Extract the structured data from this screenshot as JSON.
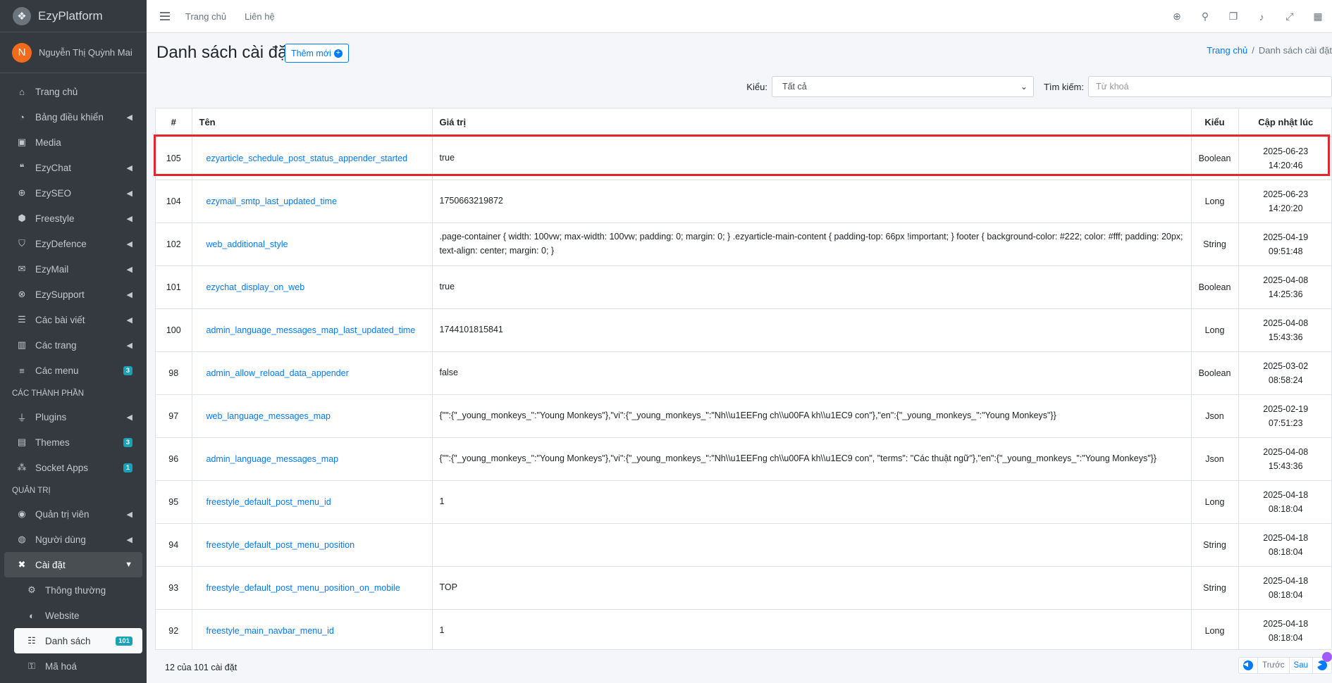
{
  "brand": {
    "name": "EzyPlatform",
    "logo_icon": "logo-icon"
  },
  "user": {
    "initial": "N",
    "name": "Nguyễn Thị Quỳnh Mai"
  },
  "sidebar": {
    "items": [
      {
        "label": "Trang chủ",
        "icon": "home-icon"
      },
      {
        "label": "Bảng điều khiển",
        "icon": "dashboard-icon"
      },
      {
        "label": "Media",
        "icon": "image-icon"
      },
      {
        "label": "EzyChat",
        "icon": "chat-icon"
      },
      {
        "label": "EzySEO",
        "icon": "search-plus-icon"
      },
      {
        "label": "Freestyle",
        "icon": "cube-icon"
      },
      {
        "label": "EzyDefence",
        "icon": "shield-icon"
      },
      {
        "label": "EzyMail",
        "icon": "mail-icon"
      },
      {
        "label": "EzySupport",
        "icon": "support-icon"
      },
      {
        "label": "Các bài viết",
        "icon": "list-icon"
      },
      {
        "label": "Các trang",
        "icon": "book-icon"
      },
      {
        "label": "Các menu",
        "icon": "menu-icon",
        "badge": "3"
      }
    ],
    "section_components": "CÁC THÀNH PHẦN",
    "components": [
      {
        "label": "Plugins",
        "icon": "plug-icon"
      },
      {
        "label": "Themes",
        "icon": "theme-icon",
        "badge": "3"
      },
      {
        "label": "Socket Apps",
        "icon": "apps-icon",
        "badge": "1"
      }
    ],
    "section_admin": "QUẢN TRỊ",
    "admin": [
      {
        "label": "Quản trị viên",
        "icon": "user-icon"
      },
      {
        "label": "Người dùng",
        "icon": "users-icon"
      },
      {
        "label": "Cài đặt",
        "icon": "tools-icon"
      }
    ],
    "settings_sub": [
      {
        "label": "Thông thường",
        "icon": "gears-icon"
      },
      {
        "label": "Website",
        "icon": "globe-icon"
      },
      {
        "label": "Danh sách",
        "icon": "list-ul-icon",
        "badge": "101"
      },
      {
        "label": "Mã hoá",
        "icon": "key-icon"
      }
    ]
  },
  "topbar": {
    "home": "Trang chủ",
    "contact": "Liên hệ"
  },
  "page": {
    "title": "Danh sách cài đặt",
    "add_button": "Thêm mới",
    "breadcrumb_home": "Trang chủ",
    "breadcrumb_sep": "/",
    "breadcrumb_current": "Danh sách cài đặt"
  },
  "filter": {
    "type_label": "Kiểu:",
    "type_value": "Tất cả",
    "search_label": "Tìm kiếm:",
    "search_placeholder": "Từ khoá"
  },
  "table": {
    "headers": [
      "#",
      "Tên",
      "Giá trị",
      "Kiểu",
      "Cập nhật lúc"
    ],
    "rows": [
      {
        "id": "105",
        "name": "ezyarticle_schedule_post_status_appender_started",
        "value": "true",
        "type": "Boolean",
        "date": "2025-06-23",
        "time": "14:20:46"
      },
      {
        "id": "104",
        "name": "ezymail_smtp_last_updated_time",
        "value": "1750663219872",
        "type": "Long",
        "date": "2025-06-23",
        "time": "14:20:20"
      },
      {
        "id": "102",
        "name": "web_additional_style",
        "value": ".page-container { width: 100vw; max-width: 100vw; padding: 0; margin: 0; } .ezyarticle-main-content { padding-top: 66px !important; } footer { background-color: #222; color: #fff; padding: 20px; text-align: center; margin: 0; }",
        "type": "String",
        "date": "2025-04-19",
        "time": "09:51:48"
      },
      {
        "id": "101",
        "name": "ezychat_display_on_web",
        "value": "true",
        "type": "Boolean",
        "date": "2025-04-08",
        "time": "14:25:36"
      },
      {
        "id": "100",
        "name": "admin_language_messages_map_last_updated_time",
        "value": "1744101815841",
        "type": "Long",
        "date": "2025-04-08",
        "time": "15:43:36"
      },
      {
        "id": "98",
        "name": "admin_allow_reload_data_appender",
        "value": "false",
        "type": "Boolean",
        "date": "2025-03-02",
        "time": "08:58:24"
      },
      {
        "id": "97",
        "name": "web_language_messages_map",
        "value": "{\"\":{\"_young_monkeys_\":\"Young Monkeys\"},\"vi\":{\"_young_monkeys_\":\"Nh\\\\u1EEFng ch\\\\u00FA kh\\\\u1EC9 con\"},\"en\":{\"_young_monkeys_\":\"Young Monkeys\"}}",
        "type": "Json",
        "date": "2025-02-19",
        "time": "07:51:23"
      },
      {
        "id": "96",
        "name": "admin_language_messages_map",
        "value": "{\"\":{\"_young_monkeys_\":\"Young Monkeys\"},\"vi\":{\"_young_monkeys_\":\"Nh\\\\u1EEFng ch\\\\u00FA kh\\\\u1EC9 con\", \"terms\": \"Các thuật ngữ\"},\"en\":{\"_young_monkeys_\":\"Young Monkeys\"}}",
        "type": "Json",
        "date": "2025-04-08",
        "time": "15:43:36"
      },
      {
        "id": "95",
        "name": "freestyle_default_post_menu_id",
        "value": "1",
        "type": "Long",
        "date": "2025-04-18",
        "time": "08:18:04"
      },
      {
        "id": "94",
        "name": "freestyle_default_post_menu_position",
        "value": "",
        "type": "String",
        "date": "2025-04-18",
        "time": "08:18:04"
      },
      {
        "id": "93",
        "name": "freestyle_default_post_menu_position_on_mobile",
        "value": "TOP",
        "type": "String",
        "date": "2025-04-18",
        "time": "08:18:04"
      },
      {
        "id": "92",
        "name": "freestyle_main_navbar_menu_id",
        "value": "1",
        "type": "Long",
        "date": "2025-04-18",
        "time": "08:18:04"
      }
    ]
  },
  "footer": {
    "summary": "12 của 101 cài đặt",
    "prev": "Trước",
    "next": "Sau"
  },
  "colors": {
    "sidebar_bg": "#343a40",
    "accent": "#007bff",
    "highlight": "#e5262f",
    "badge": "#17a2b8"
  }
}
